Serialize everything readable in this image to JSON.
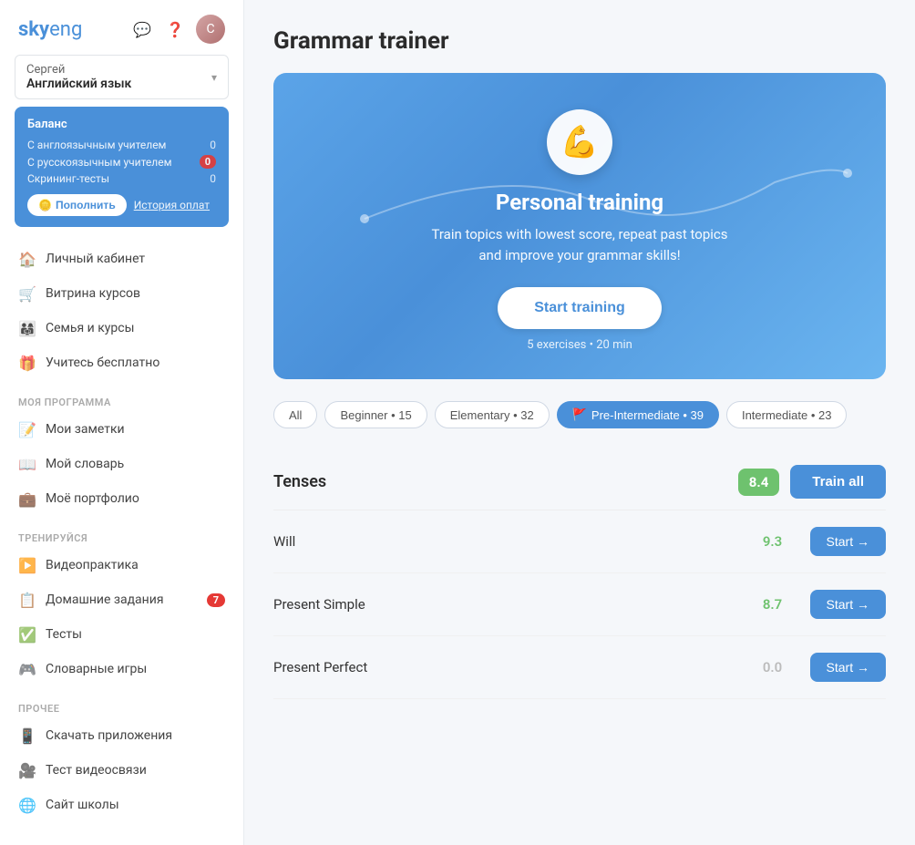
{
  "logo": {
    "text_sky": "sky",
    "text_eng": "eng"
  },
  "header_icons": [
    "💬",
    "❓"
  ],
  "sidebar": {
    "user": {
      "name": "Сергей",
      "course": "Английский язык"
    },
    "balance": {
      "title": "Баланс",
      "rows": [
        {
          "label": "С англоязычным учителем",
          "value": "0"
        },
        {
          "label": "С русскоязычным учителем",
          "value": "0",
          "badge": true
        },
        {
          "label": "Скрининг-тесты",
          "value": "0"
        }
      ],
      "btn_replenish": "Пополнить",
      "btn_history": "История оплат"
    },
    "nav_items": [
      {
        "icon": "🏠",
        "label": "Личный кабинет"
      },
      {
        "icon": "🛒",
        "label": "Витрина курсов"
      },
      {
        "icon": "👨‍👩‍👧",
        "label": "Семья и курсы"
      },
      {
        "icon": "🎁",
        "label": "Учитесь бесплатно"
      }
    ],
    "section_my_program": "МОЯ ПРОГРАММА",
    "my_program_items": [
      {
        "icon": "📝",
        "label": "Мои заметки"
      },
      {
        "icon": "📖",
        "label": "Мой словарь"
      },
      {
        "icon": "💼",
        "label": "Моё портфолио"
      }
    ],
    "section_train": "ТРЕНИРУЙСЯ",
    "train_items": [
      {
        "icon": "▶️",
        "label": "Видеопрактика"
      },
      {
        "icon": "📋",
        "label": "Домашние задания",
        "badge": "7"
      },
      {
        "icon": "✅",
        "label": "Тесты"
      },
      {
        "icon": "🎮",
        "label": "Словарные игры"
      }
    ],
    "section_other": "ПРОЧЕЕ",
    "other_items": [
      {
        "icon": "📱",
        "label": "Скачать приложения"
      },
      {
        "icon": "🎥",
        "label": "Тест видеосвязи"
      },
      {
        "icon": "🌐",
        "label": "Сайт школы"
      }
    ]
  },
  "main": {
    "page_title": "Grammar trainer",
    "hero": {
      "emoji": "💪",
      "title": "Personal training",
      "subtitle": "Train topics with lowest score, repeat past topics\nand improve your grammar skills!",
      "btn_label": "Start training",
      "meta": "5 exercises • 20 min"
    },
    "filters": [
      {
        "label": "All",
        "active": false
      },
      {
        "label": "Beginner • 15",
        "active": false
      },
      {
        "label": "Elementary • 32",
        "active": false
      },
      {
        "label": "Pre-Intermediate • 39",
        "active": true,
        "flag": true
      },
      {
        "label": "Intermediate • 23",
        "active": false
      }
    ],
    "section": {
      "title": "Tenses",
      "score": "8.4",
      "btn_train_all": "Train all"
    },
    "topics": [
      {
        "name": "Will",
        "score": "9.3",
        "zero": false,
        "btn": "Start →"
      },
      {
        "name": "Present Simple",
        "score": "8.7",
        "zero": false,
        "btn": "Start →"
      },
      {
        "name": "Present Perfect",
        "score": "0.0",
        "zero": true,
        "btn": "Start →"
      }
    ]
  }
}
